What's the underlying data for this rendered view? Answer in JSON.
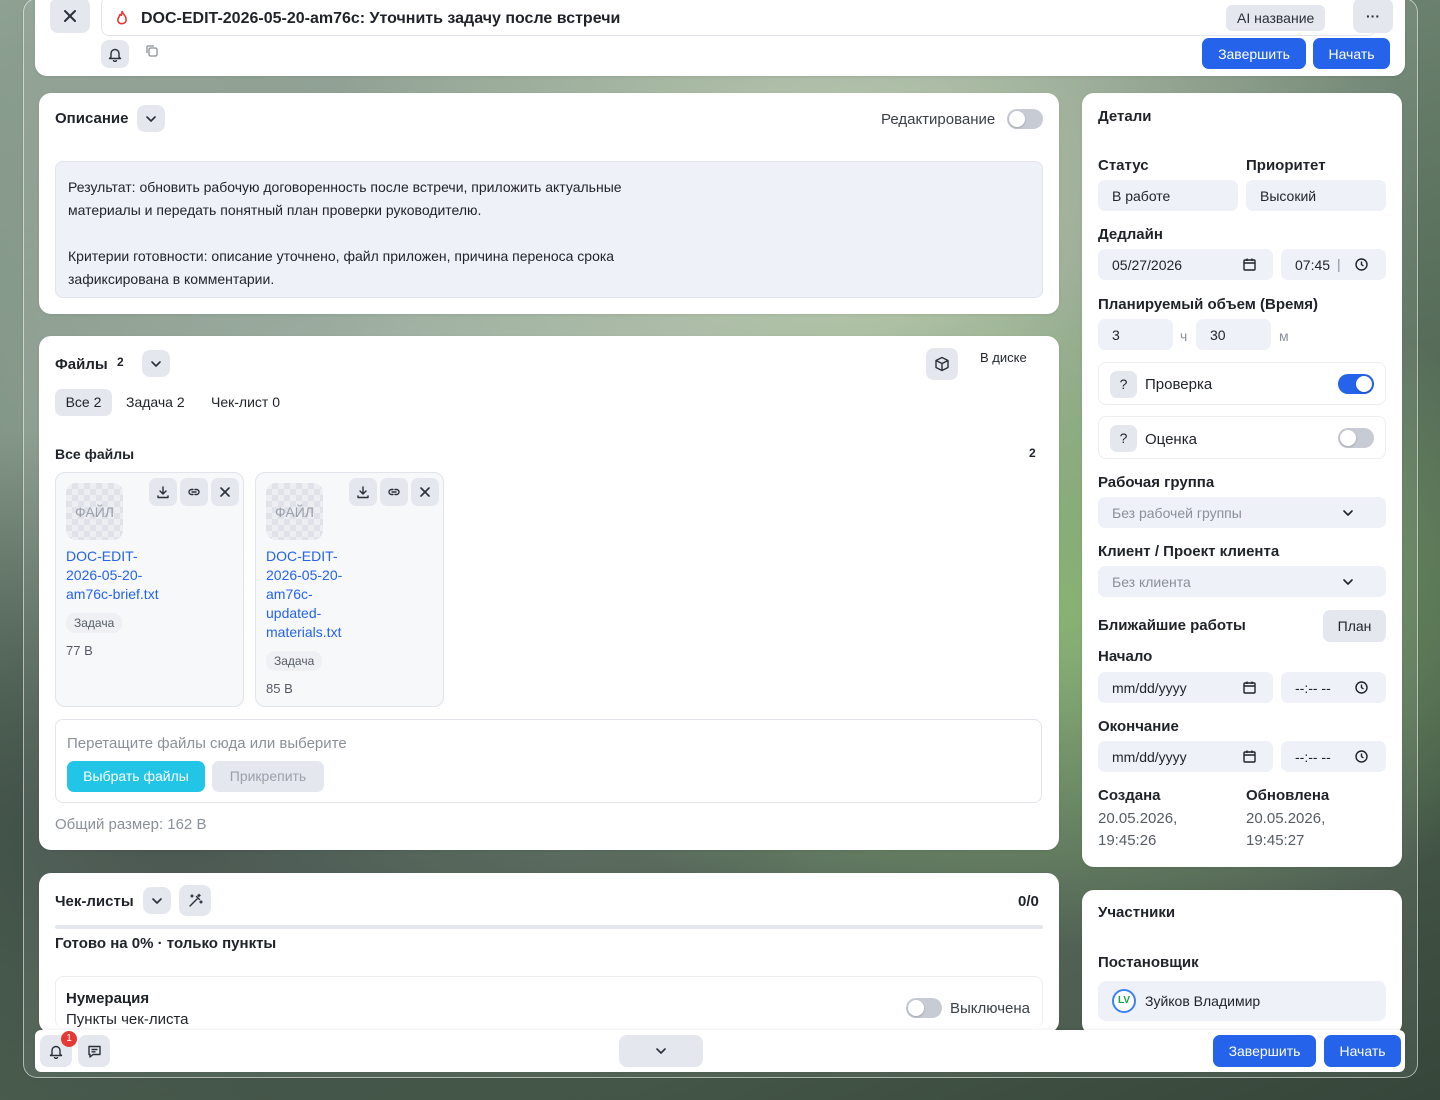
{
  "header": {
    "title": "DOC-EDIT-2026-05-20-am76c: Уточнить задачу после встречи",
    "ai_label": "AI название",
    "more_label": "···",
    "finish_label": "Завершить",
    "start_label": "Начать"
  },
  "description": {
    "title": "Описание",
    "edit_label": "Редактирование",
    "paragraph1_line1": "Результат: обновить рабочую договоренность после встречи, приложить актуальные",
    "paragraph1_line2": "материалы и передать понятный план проверки руководителю.",
    "paragraph2_line1": "Критерии готовности: описание уточнено, файл приложен, причина переноса срока",
    "paragraph2_line2": "зафиксирована в комментарии."
  },
  "files": {
    "title": "Файлы",
    "count": "2",
    "disk_label": "В диске",
    "tabs": [
      "Все 2",
      "Задача 2",
      "Чек-лист 0"
    ],
    "all_files_label": "Все файлы",
    "all_files_count": "2",
    "items": [
      {
        "thumb": "ФАЙЛ",
        "name": "DOC-EDIT-2026-05-20-am76c-brief.txt",
        "tag": "Задача",
        "size": "77 B"
      },
      {
        "thumb": "ФАЙЛ",
        "name": "DOC-EDIT-2026-05-20-am76c-updated-materials.txt",
        "tag": "Задача",
        "size": "85 B"
      }
    ],
    "drop_hint": "Перетащите файлы сюда или выберите",
    "choose_label": "Выбрать файлы",
    "attach_label": "Прикрепить",
    "total_size": "Общий размер: 162 B"
  },
  "checklists": {
    "title": "Чек-листы",
    "ratio": "0/0",
    "progress_text": "Готово на 0% · только пункты",
    "progress": 0,
    "numbering_title": "Нумерация",
    "numbering_sub": "Пункты чек-листа",
    "numbering_state": "Выключена"
  },
  "details": {
    "title": "Детали",
    "status_label": "Статус",
    "status_value": "В работе",
    "priority_label": "Приоритет",
    "priority_value": "Высокий",
    "deadline_label": "Дедлайн",
    "deadline_date": "05/27/2026",
    "deadline_time": "07:45",
    "planned_label": "Планируемый объем (Время)",
    "planned_hours": "3",
    "hours_unit": "ч",
    "planned_minutes": "30",
    "minutes_unit": "м",
    "review_label": "Проверка",
    "rating_label": "Оценка",
    "help_glyph": "?",
    "workgroup_label": "Рабочая группа",
    "workgroup_value": "Без рабочей группы",
    "client_label": "Клиент / Проект клиента",
    "client_value": "Без клиента",
    "upcoming_label": "Ближайшие работы",
    "plan_label": "План",
    "start_label": "Начало",
    "start_date": "mm/dd/yyyy",
    "start_time": "--:-- --",
    "end_label": "Окончание",
    "end_date": "mm/dd/yyyy",
    "end_time": "--:-- --",
    "created_label": "Создана",
    "created_date": "20.05.2026,",
    "created_time": "19:45:26",
    "updated_label": "Обновлена",
    "updated_date": "20.05.2026,",
    "updated_time": "19:45:27"
  },
  "participants": {
    "title": "Участники",
    "creator_label": "Постановщик",
    "creator_initials": "LV",
    "creator_name": "Зуйков Владимир"
  },
  "footer": {
    "notification_count": "1",
    "finish_label": "Завершить",
    "start_label": "Начать"
  },
  "colors": {
    "accent": "#2563eb",
    "cyan_button": "#22c5e6",
    "badge_red": "#e53935"
  }
}
